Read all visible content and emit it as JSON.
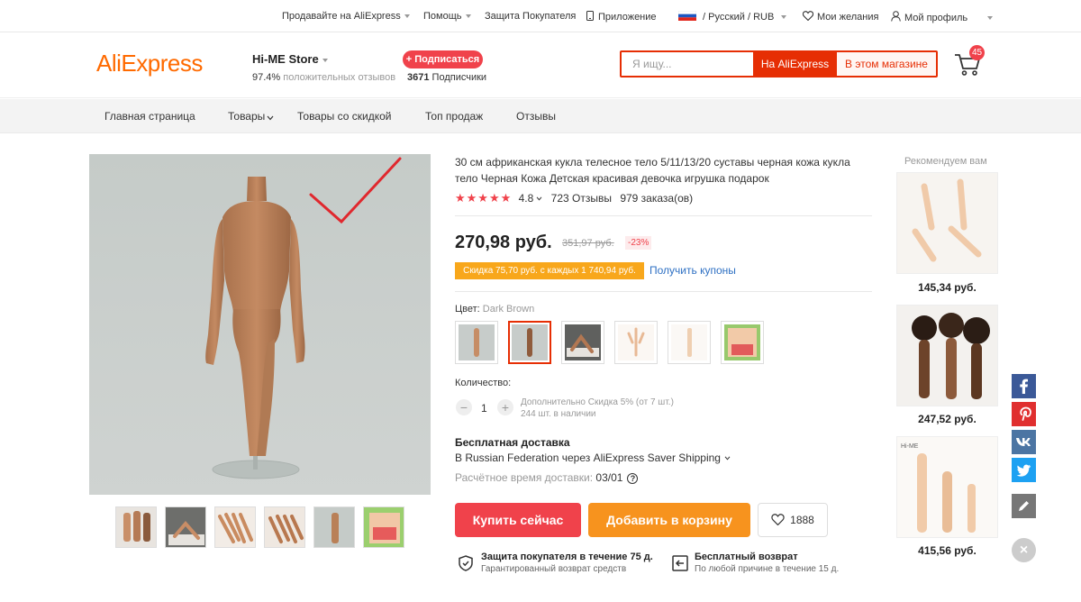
{
  "topbar": {
    "sell": "Продавайте на AliExpress",
    "help": "Помощь",
    "protection": "Защита Покупателя",
    "app": "Приложение",
    "locale": "/ Русский /  RUB",
    "wishlist": "Мои желания",
    "profile": "Мой профиль"
  },
  "header": {
    "logo": "AliExpress",
    "store_name": "Hi-ME Store",
    "rating_value": "97.4%",
    "rating_text": "положительных отзывов",
    "subscribe": "+ Подписаться",
    "subscribers_count": "3671",
    "subscribers_label": "Подписчики",
    "search_placeholder": "Я ищу...",
    "search_ali": "На AliExpress",
    "search_store": "В этом магазине",
    "cart_count": "45"
  },
  "nav": {
    "home": "Главная страница",
    "products": "Товары",
    "sale": "Товары со скидкой",
    "top": "Топ продаж",
    "reviews": "Отзывы"
  },
  "product": {
    "title": "30 см африканская кукла телесное тело 5/11/13/20 суставы черная кожа кукла тело Черная Кожа Детская красивая девочка игрушка подарок",
    "stars": "★★★★★",
    "rating": "4.8",
    "reviews": "723 Отзывы",
    "orders": "979 заказа(ов)",
    "price": "270,98 руб.",
    "old_price": "351,97 руб.",
    "discount": "-23%",
    "coupon_text": "Скидка 75,70 руб. с каждых 1 740,94 руб.",
    "coupon_link": "Получить купоны",
    "color_label": "Цвет:",
    "color_value": "Dark Brown",
    "qty_label": "Количество:",
    "qty": "1",
    "qty_minus": "−",
    "qty_plus": "+",
    "qty_info1": "Дополнительно Скидка 5% (от 7 шт.)",
    "qty_info2": "244 шт. в наличии",
    "ship_title": "Бесплатная доставка",
    "ship_line": "В Russian Federation через AliExpress Saver Shipping",
    "ship_time_label": "Расчётное время доставки:",
    "ship_time_value": "03/01",
    "buy": "Купить сейчас",
    "add_cart": "Добавить в корзину",
    "wish_count": "1888",
    "g1_title": "Защита покупателя в течение 75 д.",
    "g1_text": "Гарантированный возврат средств",
    "g2_title": "Бесплатный возврат",
    "g2_text": "По любой причине в течение 15 д."
  },
  "recommend": {
    "title": "Рекомендуем вам",
    "items": [
      {
        "price": "145,34 руб."
      },
      {
        "price": "247,52 руб."
      },
      {
        "price": "415,56 руб."
      }
    ]
  },
  "colors": {
    "accent": "#e62e04",
    "buy": "#f0424b",
    "cart": "#f7931e",
    "logo": "#ff6a00",
    "coupon": "#f8a71b",
    "link": "#2e70c3"
  }
}
